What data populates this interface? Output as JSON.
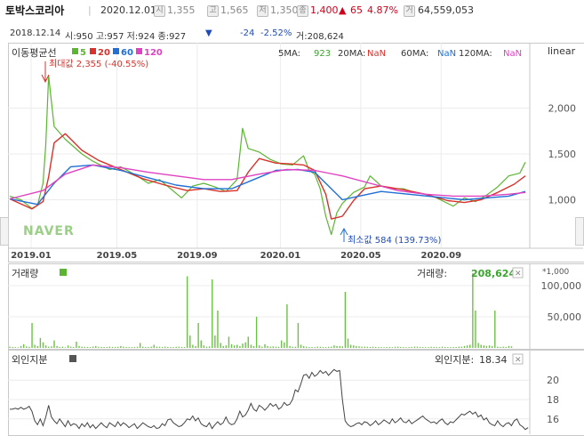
{
  "header": {
    "name": "토박스코리아",
    "date": "2020.12.01",
    "open_tag": "시",
    "open": "1,355",
    "high_tag": "고",
    "high": "1,565",
    "low_tag": "저",
    "low": "1,350",
    "close": "1,400",
    "change_arrow": "▲",
    "change": "65",
    "change_pct": "4.87%",
    "volume_tag": "거",
    "volume": "64,559,053"
  },
  "info_row": {
    "date": "2018.12.14",
    "text": "시:950 고:957 저:924 종:927",
    "arrow": "▼",
    "change": "-24",
    "change_pct": "-2.52%",
    "volume": "거:208,624"
  },
  "ma_panel": {
    "title": "이동평균선",
    "legend": [
      {
        "label": "5",
        "color": "#5cb531"
      },
      {
        "label": "20",
        "color": "#d9312b"
      },
      {
        "label": "60",
        "color": "#1f6fd6"
      },
      {
        "label": "120",
        "color": "#e042c2"
      }
    ],
    "readouts": [
      {
        "label": "5MA:",
        "value": "923",
        "color": "#3aa52c"
      },
      {
        "label": "20MA:",
        "value": "NaN",
        "color": "#d9312b"
      },
      {
        "label": "60MA:",
        "value": "NaN",
        "color": "#1f6fd6"
      },
      {
        "label": "120MA:",
        "value": "NaN",
        "color": "#e042c2"
      }
    ],
    "scale": "linear"
  },
  "annotations": {
    "max": "최대값 2,355 (-40.55%)",
    "min": "최소값 584 (139.73%)"
  },
  "watermark": "NAVER",
  "volume_panel": {
    "title": "거래량",
    "readout_label": "거래량:",
    "readout_value": "208,624",
    "unit": "*1,000",
    "close_icon": "✕"
  },
  "foreign_panel": {
    "title": "외인지분",
    "readout_label": "외인지분:",
    "readout_value": "18.34",
    "close_icon": "✕"
  },
  "chart_data": [
    {
      "type": "line",
      "panel": "price",
      "x_ticks": [
        "2019.01",
        "2019.05",
        "2019.09",
        "2020.01",
        "2020.05",
        "2020.09"
      ],
      "y_ticks": [
        1000,
        1500,
        2000
      ],
      "ylim": [
        500,
        2500
      ],
      "series": [
        {
          "name": "5",
          "color": "#5cb531",
          "points": [
            [
              0,
              1040
            ],
            [
              4,
              1000
            ],
            [
              8,
              905
            ],
            [
              10,
              940
            ],
            [
              12,
              1180
            ],
            [
              13,
              1600
            ],
            [
              14,
              2350
            ],
            [
              16,
              1800
            ],
            [
              20,
              1660
            ],
            [
              26,
              1500
            ],
            [
              30,
              1420
            ],
            [
              36,
              1330
            ],
            [
              40,
              1360
            ],
            [
              46,
              1260
            ],
            [
              50,
              1180
            ],
            [
              54,
              1220
            ],
            [
              58,
              1120
            ],
            [
              62,
              1020
            ],
            [
              66,
              1150
            ],
            [
              70,
              1180
            ],
            [
              74,
              1140
            ],
            [
              78,
              1090
            ],
            [
              82,
              1220
            ],
            [
              84,
              1780
            ],
            [
              86,
              1560
            ],
            [
              90,
              1520
            ],
            [
              94,
              1440
            ],
            [
              98,
              1390
            ],
            [
              102,
              1380
            ],
            [
              106,
              1480
            ],
            [
              108,
              1320
            ],
            [
              110,
              1280
            ],
            [
              112,
              1120
            ],
            [
              114,
              820
            ],
            [
              116,
              620
            ],
            [
              118,
              860
            ],
            [
              120,
              960
            ],
            [
              124,
              1080
            ],
            [
              128,
              1140
            ],
            [
              130,
              1260
            ],
            [
              134,
              1150
            ],
            [
              138,
              1120
            ],
            [
              142,
              1120
            ],
            [
              146,
              1080
            ],
            [
              150,
              1060
            ],
            [
              154,
              1020
            ],
            [
              158,
              960
            ],
            [
              160,
              930
            ],
            [
              164,
              1020
            ],
            [
              168,
              980
            ],
            [
              172,
              1050
            ],
            [
              176,
              1140
            ],
            [
              180,
              1260
            ],
            [
              184,
              1290
            ],
            [
              186,
              1410
            ]
          ]
        },
        {
          "name": "20",
          "color": "#d9312b",
          "points": [
            [
              0,
              1010
            ],
            [
              8,
              900
            ],
            [
              12,
              980
            ],
            [
              14,
              1250
            ],
            [
              16,
              1620
            ],
            [
              20,
              1720
            ],
            [
              26,
              1540
            ],
            [
              32,
              1430
            ],
            [
              40,
              1330
            ],
            [
              48,
              1230
            ],
            [
              56,
              1160
            ],
            [
              64,
              1100
            ],
            [
              70,
              1120
            ],
            [
              76,
              1090
            ],
            [
              82,
              1100
            ],
            [
              86,
              1300
            ],
            [
              90,
              1450
            ],
            [
              96,
              1400
            ],
            [
              102,
              1390
            ],
            [
              106,
              1380
            ],
            [
              110,
              1320
            ],
            [
              114,
              1060
            ],
            [
              116,
              790
            ],
            [
              120,
              820
            ],
            [
              124,
              990
            ],
            [
              128,
              1120
            ],
            [
              134,
              1150
            ],
            [
              142,
              1110
            ],
            [
              150,
              1060
            ],
            [
              158,
              990
            ],
            [
              164,
              970
            ],
            [
              170,
              1000
            ],
            [
              176,
              1080
            ],
            [
              182,
              1170
            ],
            [
              186,
              1260
            ]
          ]
        },
        {
          "name": "60",
          "color": "#1f6fd6",
          "points": [
            [
              0,
              1010
            ],
            [
              10,
              950
            ],
            [
              16,
              1180
            ],
            [
              22,
              1360
            ],
            [
              30,
              1380
            ],
            [
              40,
              1320
            ],
            [
              50,
              1240
            ],
            [
              60,
              1160
            ],
            [
              70,
              1120
            ],
            [
              80,
              1120
            ],
            [
              88,
              1220
            ],
            [
              96,
              1320
            ],
            [
              104,
              1330
            ],
            [
              110,
              1300
            ],
            [
              116,
              1120
            ],
            [
              120,
              1000
            ],
            [
              126,
              1040
            ],
            [
              134,
              1090
            ],
            [
              144,
              1060
            ],
            [
              154,
              1030
            ],
            [
              164,
              1000
            ],
            [
              172,
              1020
            ],
            [
              180,
              1040
            ],
            [
              186,
              1090
            ]
          ]
        },
        {
          "name": "120",
          "color": "#e042c2",
          "points": [
            [
              0,
              1010
            ],
            [
              12,
              1100
            ],
            [
              20,
              1280
            ],
            [
              30,
              1380
            ],
            [
              40,
              1350
            ],
            [
              50,
              1300
            ],
            [
              60,
              1260
            ],
            [
              70,
              1220
            ],
            [
              80,
              1220
            ],
            [
              90,
              1280
            ],
            [
              100,
              1330
            ],
            [
              110,
              1320
            ],
            [
              120,
              1260
            ],
            [
              130,
              1180
            ],
            [
              140,
              1100
            ],
            [
              150,
              1060
            ],
            [
              160,
              1040
            ],
            [
              170,
              1040
            ],
            [
              180,
              1060
            ],
            [
              186,
              1080
            ]
          ]
        }
      ]
    },
    {
      "type": "bar",
      "panel": "volume",
      "y_ticks": [
        50000,
        100000
      ],
      "ylim": [
        0,
        130000
      ],
      "values": [
        2000,
        1500,
        1200,
        900,
        3000,
        6000,
        2500,
        1800,
        40000,
        5000,
        3000,
        16000,
        9000,
        4000,
        2000,
        2500,
        12000,
        3000,
        1500,
        2000,
        1000,
        4000,
        2000,
        1500,
        10000,
        3000,
        2000,
        1800,
        1600,
        1400,
        2200,
        3000,
        1800,
        1600,
        1500,
        1400,
        2000,
        1600,
        1500,
        1800,
        3000,
        2000,
        1500,
        1400,
        1300,
        1600,
        1800,
        8000,
        2000,
        1500,
        1500,
        2000,
        5000,
        2000,
        1800,
        1600,
        2000,
        1500,
        1400,
        1300,
        1800,
        2000,
        1500,
        1400,
        115000,
        20000,
        5000,
        3000,
        40000,
        12000,
        4000,
        2000,
        2500,
        110000,
        20000,
        60000,
        8000,
        3000,
        4000,
        18000,
        6000,
        4000,
        5000,
        3000,
        7000,
        9000,
        18000,
        5000,
        3000,
        50000,
        4000,
        2000,
        6000,
        3000,
        2000,
        2500,
        2000,
        1800,
        12000,
        9000,
        70000,
        3000,
        2000,
        1800,
        40000,
        5000,
        3000,
        2000,
        1500,
        1400,
        1300,
        2000,
        1800,
        1500,
        1300,
        1800,
        2000,
        4000,
        3000,
        3000,
        2500,
        90000,
        15000,
        5000,
        4000,
        3000,
        2500,
        2000,
        2000,
        1800,
        1600,
        2000,
        1500,
        1400,
        1300,
        1200,
        1500,
        1400,
        1300,
        1800,
        2000,
        1500,
        1400,
        1200,
        1300,
        1500,
        2000,
        2000,
        1500,
        1400,
        1200,
        1300,
        1800,
        1500,
        1400,
        1300,
        2000,
        1500,
        1200,
        1300,
        1400,
        1500,
        2000,
        2000,
        3000,
        4000,
        5000,
        120000,
        60000,
        8000,
        5000,
        4000,
        3000,
        4000,
        3000,
        60000,
        2000,
        1500,
        2000,
        1500,
        3000,
        2500
      ]
    },
    {
      "type": "line",
      "panel": "foreign_ownership",
      "y_ticks": [
        16,
        18,
        20
      ],
      "ylim": [
        14.6,
        21.4
      ],
      "values": [
        17.0,
        17.0,
        17.1,
        17.0,
        17.2,
        17.0,
        17.1,
        17.3,
        16.8,
        15.8,
        15.4,
        16.0,
        15.3,
        16.2,
        17.4,
        16.2,
        15.8,
        15.5,
        16.0,
        15.6,
        15.2,
        15.8,
        15.3,
        15.5,
        15.4,
        15.0,
        15.5,
        15.2,
        15.6,
        15.1,
        15.4,
        15.0,
        15.3,
        15.6,
        15.3,
        15.1,
        15.6,
        15.4,
        15.2,
        15.7,
        15.3,
        15.6,
        15.4,
        15.1,
        15.3,
        15.5,
        15.0,
        15.3,
        15.6,
        15.4,
        15.2,
        15.1,
        15.3,
        15.0,
        15.1,
        15.5,
        15.3,
        15.9,
        16.0,
        15.6,
        15.4,
        15.2,
        15.3,
        15.6,
        16.0,
        15.9,
        16.3,
        15.8,
        16.1,
        15.5,
        15.3,
        15.2,
        15.6,
        15.0,
        15.4,
        15.7,
        15.4,
        15.6,
        16.2,
        15.6,
        15.4,
        15.5,
        16.0,
        16.8,
        16.2,
        16.4,
        16.9,
        17.6,
        17.0,
        16.8,
        17.4,
        17.2,
        16.9,
        17.2,
        17.6,
        17.3,
        17.5,
        17.0,
        17.2,
        17.7,
        17.4,
        17.5,
        18.0,
        19.0,
        18.8,
        19.6,
        20.5,
        20.6,
        20.2,
        20.8,
        20.4,
        20.6,
        21.0,
        20.7,
        20.9,
        20.5,
        20.8,
        21.1,
        20.9,
        21.0,
        18.0,
        15.8,
        15.4,
        15.2,
        15.3,
        15.5,
        15.6,
        15.4,
        15.7,
        15.6,
        15.3,
        15.5,
        15.8,
        15.4,
        15.6,
        15.9,
        15.7,
        15.5,
        16.0,
        15.6,
        15.8,
        16.1,
        15.7,
        15.6,
        15.9,
        15.5,
        15.7,
        15.9,
        16.1,
        16.3,
        16.0,
        15.8,
        15.6,
        15.7,
        15.5,
        15.8,
        16.0,
        15.6,
        15.4,
        15.7,
        15.6,
        15.9,
        16.2,
        16.5,
        16.4,
        16.6,
        16.8,
        16.5,
        16.7,
        16.2,
        16.4,
        15.9,
        16.1,
        15.6,
        15.4,
        15.3,
        15.8,
        15.4,
        15.2,
        15.5,
        15.6,
        15.3,
        15.8,
        16.0,
        15.4,
        15.2,
        14.9,
        15.1
      ]
    }
  ]
}
